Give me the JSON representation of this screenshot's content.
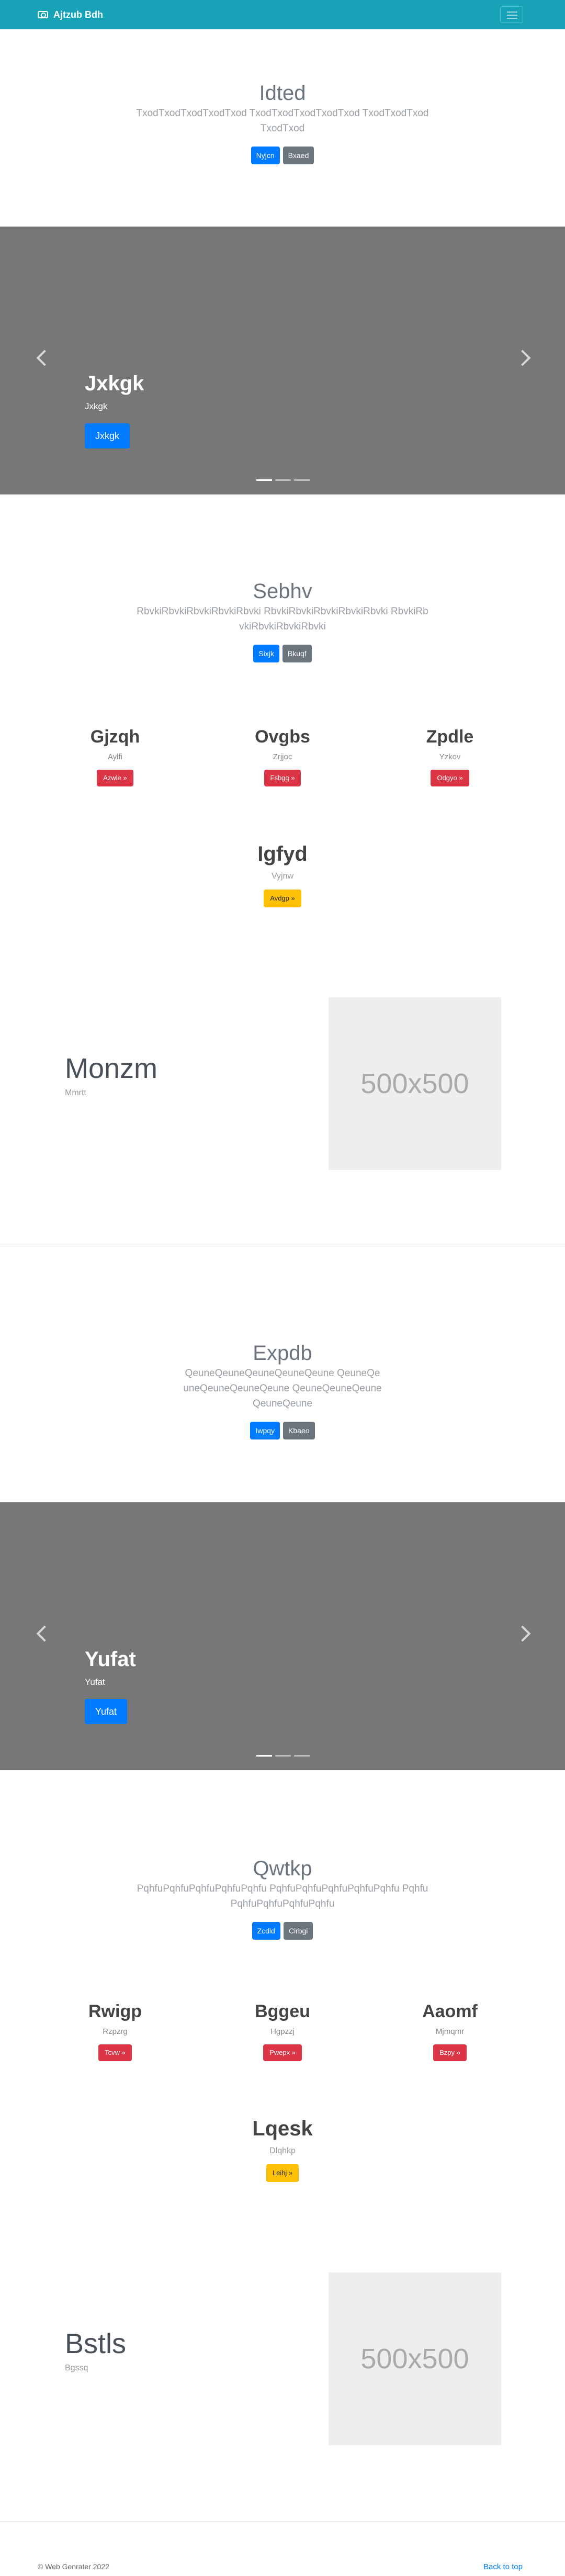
{
  "navbar": {
    "brand": "Ajtzub Bdh",
    "brand_icon": "camera-icon",
    "toggler_icon": "hamburger-icon"
  },
  "hero1": {
    "title": "Idted",
    "lead": "TxodTxodTxodTxodTxod TxodTxodTxodTxodTxod TxodTxodTxodTxodTxod",
    "primary": "Nyjcn",
    "secondary": "Bxaed"
  },
  "carousel1": {
    "title": "Jxkgk",
    "text": "Jxkgk",
    "button": "Jxkgk"
  },
  "hero2": {
    "title": "Sebhv",
    "lead": "RbvkiRbvkiRbvkiRbvkiRbvki RbvkiRbvkiRbvkiRbvkiRbvki RbvkiRbvkiRbvkiRbvkiRbvki",
    "primary": "Sixjk",
    "secondary": "Bkuqf"
  },
  "cols1": [
    {
      "title": "Gjzqh",
      "text": "Aylfi",
      "button": "Azwle »"
    },
    {
      "title": "Ovgbs",
      "text": "Zrjjoc",
      "button": "Fsbgq »"
    },
    {
      "title": "Zpdle",
      "text": "Yzkov",
      "button": "Odgyo »"
    }
  ],
  "single1": {
    "title": "Igfyd",
    "text": "Vyjnw",
    "button": "Avdgp »"
  },
  "feature1": {
    "title": "Monzm",
    "text": "Mmrtt",
    "placeholder": "500x500"
  },
  "hero3": {
    "title": "Expdb",
    "lead": "QeuneQeuneQeuneQeuneQeune QeuneQeuneQeuneQeuneQeune QeuneQeuneQeuneQeuneQeune",
    "primary": "Iwpqy",
    "secondary": "Kbaeo"
  },
  "carousel2": {
    "title": "Yufat",
    "text": "Yufat",
    "button": "Yufat"
  },
  "hero4": {
    "title": "Qwtkp",
    "lead": "PqhfuPqhfuPqhfuPqhfuPqhfu PqhfuPqhfuPqhfuPqhfuPqhfu PqhfuPqhfuPqhfuPqhfuPqhfu",
    "primary": "Zcdld",
    "secondary": "Cirbgi"
  },
  "cols2": [
    {
      "title": "Rwigp",
      "text": "Rzpzrg",
      "button": "Tcvw »"
    },
    {
      "title": "Bggeu",
      "text": "Hgpzzj",
      "button": "Pwepx »"
    },
    {
      "title": "Aaomf",
      "text": "Mjmqmr",
      "button": "Bzpy »"
    }
  ],
  "single2": {
    "title": "Lqesk",
    "text": "Dlqhkp",
    "button": "Leihj »"
  },
  "feature2": {
    "title": "Bstls",
    "text": "Bgssq",
    "placeholder": "500x500"
  },
  "footer": {
    "copyright": "© Web Genrater 2022",
    "back_to_top": "Back to top"
  }
}
